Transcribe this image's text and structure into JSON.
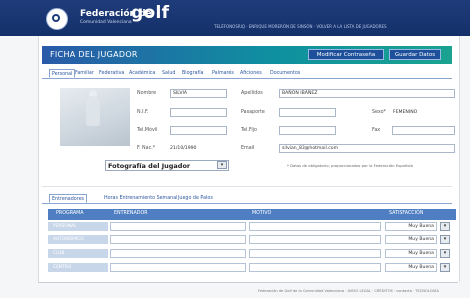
{
  "header": {
    "brand_name": "Federación de",
    "brand_golf": "golf",
    "brand_sub": "Comunidad Valenciana",
    "top_links": "TELÉFONOSRIQ · ENRIQUE MORERÓN DE SINSÓN · VOLVER A LA LISTA DE JUGADORES"
  },
  "title_bar": {
    "title": "FICHA DEL JUGADOR",
    "change_password": "Modificar Contraseña",
    "save": "Guardar Datos"
  },
  "tabs": [
    "Personal",
    "Familiar",
    "Federativa",
    "Académica",
    "Salud",
    "Biografía",
    "Palmarés",
    "Aficiones",
    "Documentos"
  ],
  "form": {
    "labels": {
      "nombre": "Nombre",
      "apellidos": "Apellidos",
      "nif": "N.I.F.",
      "pasaporte": "Pasaporte",
      "sexo": "Sexo*",
      "tel_movil": "Tel.Móvil",
      "tel_fijo": "Tel.Fijo",
      "fax": "Fax",
      "f_nac": "F. Nac.*",
      "email": "Email"
    },
    "values": {
      "nombre": "SILVIA",
      "apellidos": "BAÑÓN IBÁÑEZ",
      "sexo": "FEMENINO",
      "f_nac": "21/10/1990",
      "email": "silvian_83@hotmail.com"
    },
    "photo_select": "Fotografía del Jugador",
    "note": "* Datos de obligatorio, proporcionados por la Federación Española"
  },
  "tabs2": [
    "Entrenadores",
    "Horas Entrenamiento Semanal",
    "Juego de Palos"
  ],
  "table": {
    "headers": [
      "PROGRAMA",
      "ENTRENADOR",
      "MOTIVO",
      "SATISFACCIÓN"
    ],
    "rows": [
      {
        "programa": "PERSONAL",
        "satisfaccion": "Muy Buena"
      },
      {
        "programa": "AUTONÓMICO",
        "satisfaccion": "Muy Buena"
      },
      {
        "programa": "CLUB",
        "satisfaccion": "Muy Buena"
      },
      {
        "programa": "CENTRO",
        "satisfaccion": "Muy Buena"
      }
    ]
  },
  "footer": {
    "text": "Federación de Golf de la Comunidad Valenciana · AVISO LEGAL · CRÉDITOS · contacto · TECNOLOGÍA"
  },
  "colors": {
    "header_bg": "#1f3c7a",
    "title_gradient_start": "#2a5aa8",
    "title_gradient_end": "#1aa390",
    "table_header": "#4f7fc2",
    "row_label_bg": "#c8d6ea",
    "link_blue": "#2e57a0"
  },
  "icons": {
    "logo": "federation-ball-logo",
    "dropdown": "chevron-down-icon"
  }
}
